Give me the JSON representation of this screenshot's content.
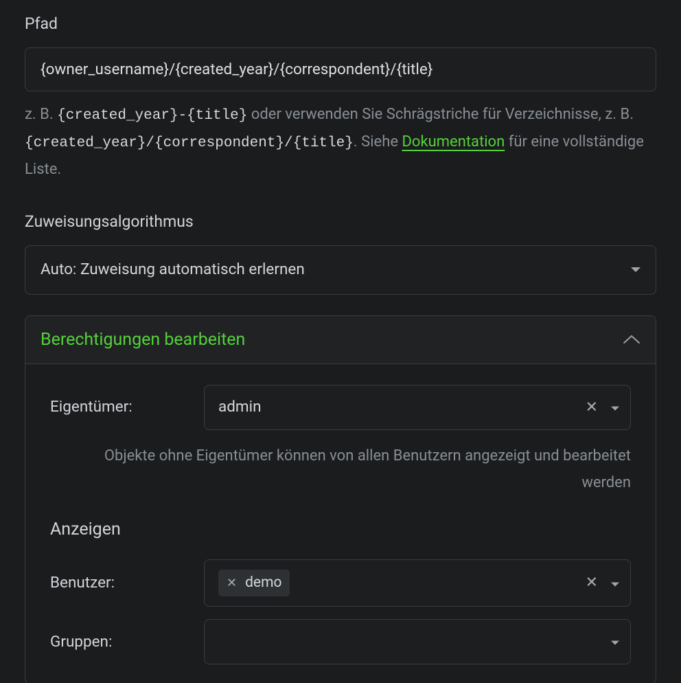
{
  "path": {
    "label": "Pfad",
    "value": "{owner_username}/{created_year}/{correspondent}/{title}",
    "help_prefix": "z. B. ",
    "help_mono1": "{created_year}-{title}",
    "help_mid": " oder verwenden Sie Schrägstriche für Verzeichnisse, z. B. ",
    "help_mono2": "{created_year}/{correspondent}/{title}",
    "help_after": ". Siehe ",
    "doc_link": "Dokumentation",
    "help_tail": " für eine vollständige Liste."
  },
  "algorithm": {
    "label": "Zuweisungsalgorithmus",
    "value": "Auto: Zuweisung automatisch erlernen"
  },
  "permissions": {
    "title": "Berechtigungen bearbeiten",
    "owner": {
      "label": "Eigentümer:",
      "value": "admin",
      "help": "Objekte ohne Eigentümer können von allen Benutzern angezeigt und bearbeitet werden"
    },
    "view": {
      "section": "Anzeigen",
      "users_label": "Benutzer:",
      "users_chip": "demo",
      "groups_label": "Gruppen:"
    }
  }
}
